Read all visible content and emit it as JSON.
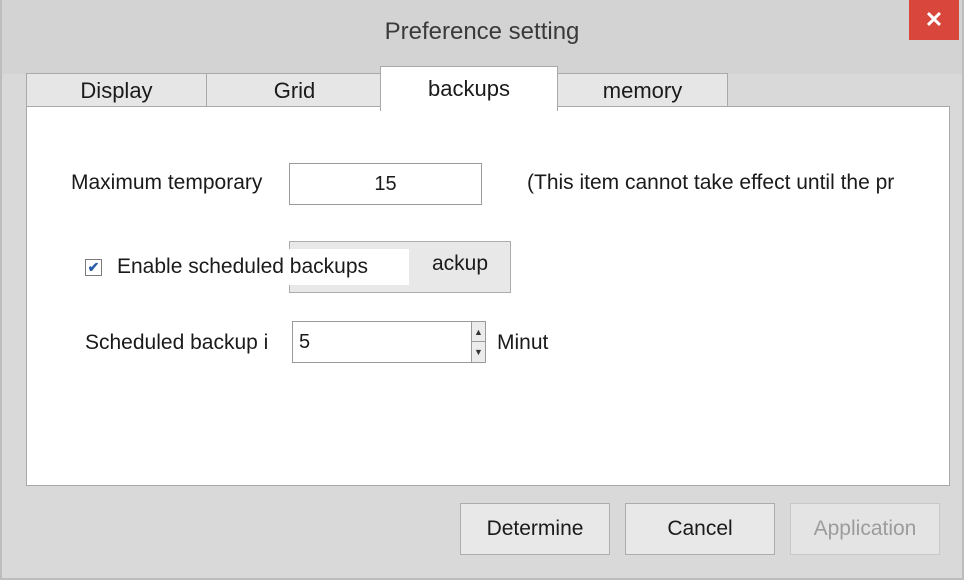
{
  "window": {
    "title": "Preference setting",
    "close_glyph": "✕"
  },
  "tabs": [
    {
      "label": "Display"
    },
    {
      "label": "Grid"
    },
    {
      "label": "backups",
      "active": true
    },
    {
      "label": "memory"
    }
  ],
  "backups": {
    "max_temp_label": "Maximum temporary",
    "max_temp_value": "15",
    "note_text": "(This item cannot take effect until the pr",
    "enable_scheduled_label": "Enable scheduled backups",
    "enable_scheduled_checked": true,
    "backup_button_label": "ackup",
    "interval_label": "Scheduled backup i",
    "interval_value": "5",
    "interval_unit": "Minut"
  },
  "footer": {
    "determine_label": "Determine",
    "cancel_label": "Cancel",
    "application_label": "Application"
  },
  "colors": {
    "close_button": "#d9463c",
    "window_bg": "#d9d9d9",
    "checkbox_mark": "#2a5da8"
  },
  "icons": {
    "close": "close-icon",
    "check": "checkmark-icon",
    "spin_up": "spin-up-icon",
    "spin_down": "spin-down-icon"
  }
}
